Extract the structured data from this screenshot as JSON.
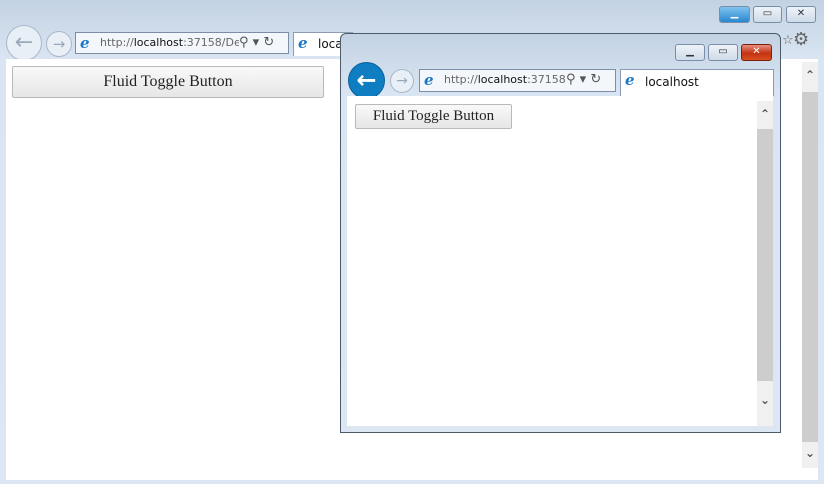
{
  "outer_window": {
    "address": {
      "prefix": "http://",
      "host": "localhost",
      "rest": ":37158/De"
    },
    "tab_title": "loca",
    "button_label": "Fluid Toggle Button"
  },
  "inner_window": {
    "address": {
      "prefix": "http://",
      "host": "localhost",
      "rest": ":37158,"
    },
    "tab_title": "localhost",
    "button_label": "Fluid Toggle Button"
  },
  "icons": {
    "back": "←",
    "forward": "→",
    "search": "⚲",
    "dropdown": "▾",
    "refresh": "↻",
    "ie": "e",
    "gear": "⚙",
    "star": "☆",
    "minimize": "▁",
    "restore": "▭",
    "close": "✕",
    "scroll_up": "⌃",
    "scroll_down": "⌄"
  }
}
